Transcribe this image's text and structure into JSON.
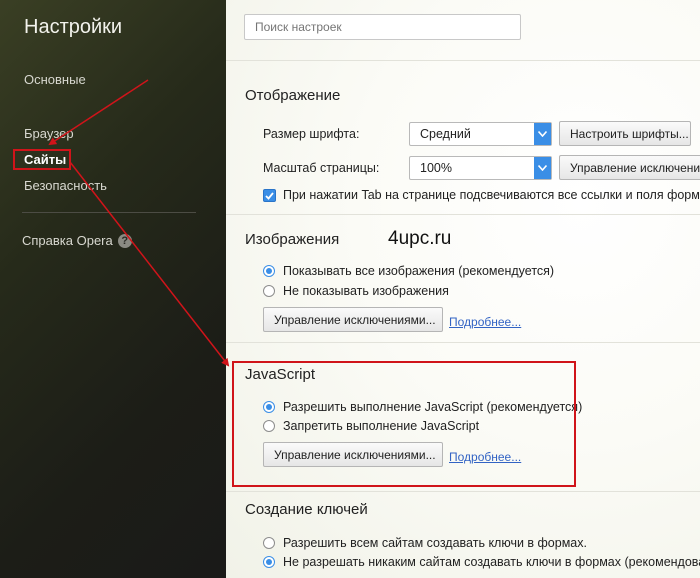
{
  "sidebar": {
    "title": "Настройки",
    "items": [
      {
        "label": "Основные"
      },
      {
        "label": "Браузер"
      },
      {
        "label": "Сайты"
      },
      {
        "label": "Безопасность"
      }
    ],
    "help": {
      "label": "Справка Opera",
      "icon": "help-icon"
    }
  },
  "search": {
    "placeholder": "Поиск настроек"
  },
  "display": {
    "title": "Отображение",
    "font_size_label": "Размер шрифта:",
    "font_size_value": "Средний",
    "font_button": "Настроить шрифты...",
    "zoom_label": "Масштаб страницы:",
    "zoom_value": "100%",
    "zoom_button": "Управление исключения",
    "tab_checkbox_label": "При нажатии Tab на странице подсвечиваются все ссылки и поля форм",
    "tab_checkbox_checked": true
  },
  "images": {
    "title": "Изображения",
    "options": [
      {
        "label": "Показывать все изображения (рекомендуется)",
        "checked": true
      },
      {
        "label": "Не показывать изображения",
        "checked": false
      }
    ],
    "manage_button": "Управление исключениями...",
    "more_link": "Подробнее..."
  },
  "watermark": "4upc.ru",
  "javascript": {
    "title": "JavaScript",
    "options": [
      {
        "label": "Разрешить выполнение JavaScript (рекомендуется)",
        "checked": true
      },
      {
        "label": "Запретить выполнение JavaScript",
        "checked": false
      }
    ],
    "manage_button": "Управление исключениями...",
    "more_link": "Подробнее..."
  },
  "keygen": {
    "title": "Создание ключей",
    "options": [
      {
        "label": "Разрешить всем сайтам создавать ключи в формах.",
        "checked": false
      },
      {
        "label": "Не разрешать никаким сайтам создавать ключи в формах (рекомендовано).",
        "checked": true
      }
    ]
  },
  "colors": {
    "accent": "#3a8ee6",
    "highlight": "#d0141a",
    "link": "#3263c4"
  }
}
